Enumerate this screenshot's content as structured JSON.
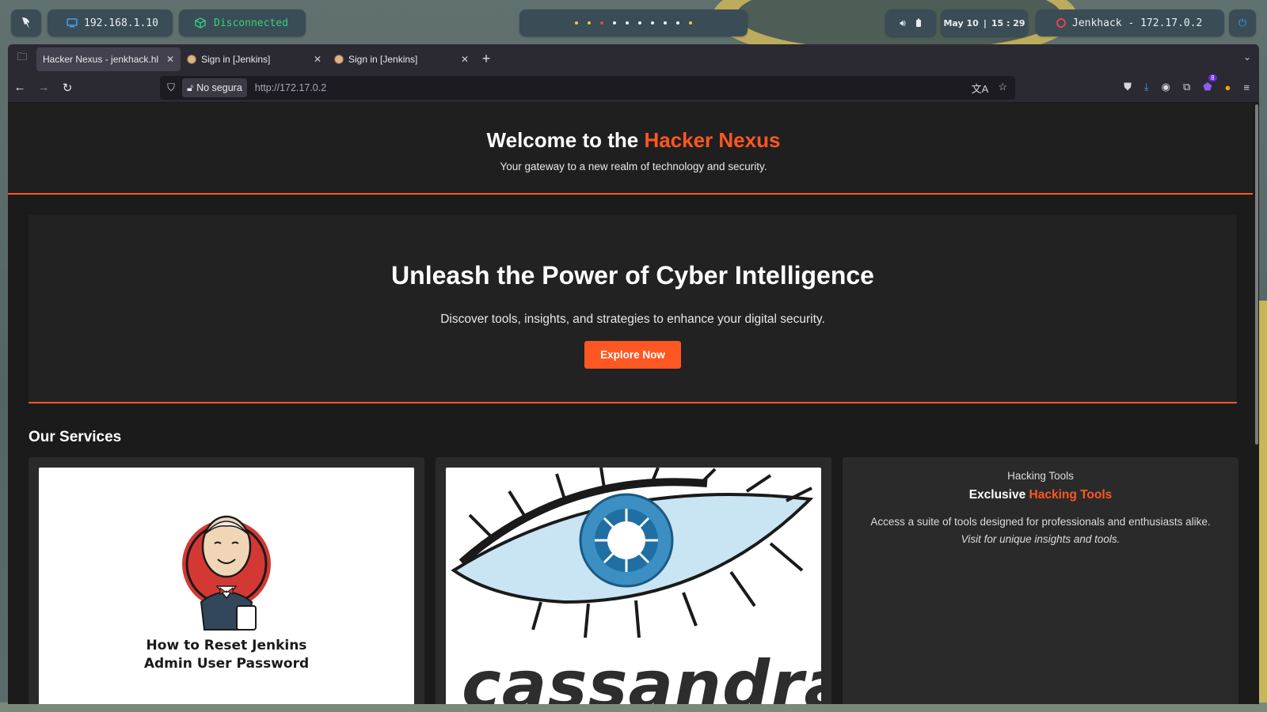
{
  "topbar": {
    "ip": "192.168.1.10",
    "vpn_status": "Disconnected",
    "clock_date": "May 10",
    "clock_time": "15 : 29",
    "target": "Jenkhack - 172.17.0.2",
    "workspace_dot_colors": [
      "#f5c542",
      "#f5c542",
      "#e04848",
      "#f2f2f2",
      "#f2f2f2",
      "#f2f2f2",
      "#f2f2f2",
      "#f2f2f2",
      "#f2f2f2",
      "#f5c542"
    ]
  },
  "browser": {
    "tabs": [
      {
        "title": "Hacker Nexus - jenkhack.hl",
        "active": true
      },
      {
        "title": "Sign in [Jenkins]",
        "active": false
      },
      {
        "title": "Sign in [Jenkins]",
        "active": false
      }
    ],
    "security_label": "No segura",
    "url": "http://172.17.0.2",
    "extension_badge_count": "8"
  },
  "site": {
    "header_title_prefix": "Welcome to the ",
    "header_title_accent": "Hacker Nexus",
    "header_subtitle": "Your gateway to a new realm of technology and security.",
    "hero_title": "Unleash the Power of Cyber Intelligence",
    "hero_text": "Discover tools, insights, and strategies to enhance your digital security.",
    "hero_button": "Explore Now",
    "services_title": "Our Services",
    "cards": [
      {
        "image_caption_line1": "How to Reset Jenkins",
        "image_caption_line2": "Admin User Password"
      },
      {
        "image_word": "cassandra"
      },
      {
        "label": "Hacking Tools",
        "title_prefix": "Exclusive ",
        "title_accent": "Hacking Tools",
        "description": "Access a suite of tools designed for professionals and enthusiasts alike.",
        "note": "Visit for unique insights and tools."
      }
    ]
  },
  "colors": {
    "accent": "#ff5722",
    "vpn_disconnected": "#38d17a",
    "page_bg": "#1b1b1b"
  }
}
